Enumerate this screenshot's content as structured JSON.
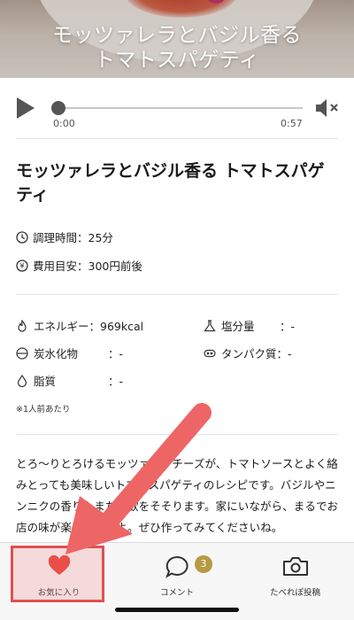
{
  "hero": {
    "title_line1": "モッツァレラとバジル香る",
    "title_line2": "トマトスパゲティ"
  },
  "player": {
    "current_time": "0:00",
    "duration": "0:57",
    "progress": 0,
    "muted": true
  },
  "recipe": {
    "title": "モッツァレラとバジル香る トマトスパゲティ",
    "cook_time": "調理時間：25分",
    "cost": "費用目安：300円前後"
  },
  "nutrition": {
    "energy": {
      "label": "エネルギー",
      "value": "：969kcal",
      "icon": "flame-icon"
    },
    "salt": {
      "label": "塩分量",
      "value": "：-",
      "icon": "flask-icon"
    },
    "carbs": {
      "label": "炭水化物",
      "value": "：-",
      "icon": "bowl-icon"
    },
    "protein": {
      "label": "タンパク質",
      "value": "：-",
      "icon": "bean-icon"
    },
    "fat": {
      "label": "脂質",
      "value": "：-",
      "icon": "drop-icon"
    },
    "note": "※1人前あたり"
  },
  "description": "とろ〜りとろけるモッツァレラチーズが、トマトソースとよく絡みとっても美味しいトマトスパゲティのレシピです。バジルやニンニクの香りもまた食欲をそそります。家にいながら、まるでお店の味が楽しめますよ。ぜひ作ってみてくださいね。",
  "bottom_nav": {
    "favorite": {
      "label": "お気に入り",
      "icon": "heart-icon",
      "color": "#e8453c"
    },
    "comment": {
      "label": "コメント",
      "icon": "speech-bubble-icon",
      "badge": "3"
    },
    "post": {
      "label": "たべれぽ投稿",
      "icon": "camera-icon"
    }
  },
  "colors": {
    "accent_heart": "#e8453c",
    "badge": "#b79a43",
    "annotation": "#e05050"
  }
}
